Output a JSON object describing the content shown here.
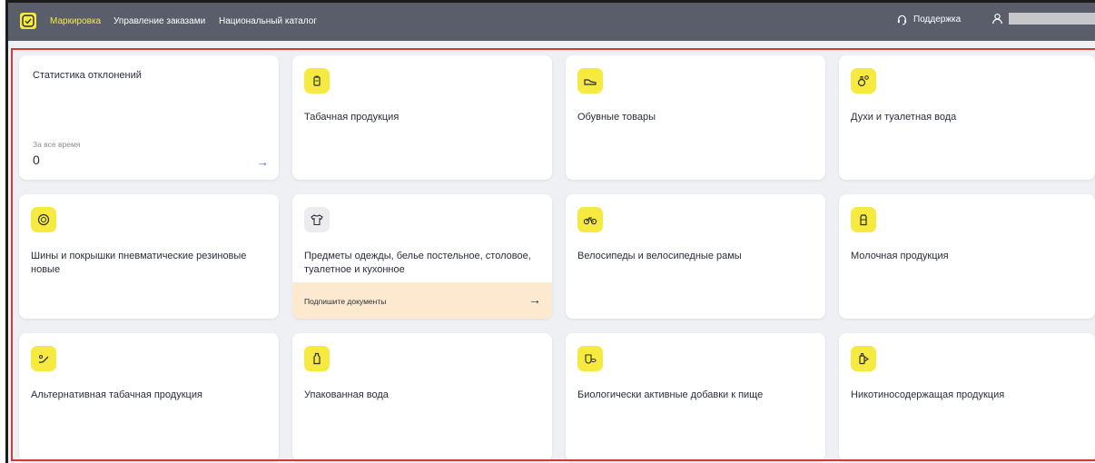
{
  "header": {
    "nav": [
      {
        "label": "Маркировка",
        "active": true
      },
      {
        "label": "Управление заказами",
        "active": false
      },
      {
        "label": "Национальный каталог",
        "active": false
      }
    ],
    "support_label": "Поддержка",
    "accent_color": "#f6e93f"
  },
  "stats_card": {
    "title": "Статистика отклонений",
    "period_label": "За все время",
    "value": "0",
    "arrow": "→"
  },
  "categories": [
    {
      "title": "Табачная продукция",
      "icon": "cigarette-pack-icon"
    },
    {
      "title": "Обувные товары",
      "icon": "shoe-icon"
    },
    {
      "title": "Духи и туалетная вода",
      "icon": "perfume-icon"
    },
    {
      "title": "Шины и покрышки пневматические резиновые новые",
      "icon": "tire-icon"
    },
    {
      "title": "Предметы одежды, белье постельное, столовое, туалетное и кухонное",
      "icon": "shirt-icon",
      "action_label": "Подпишите документы",
      "action_arrow": "→"
    },
    {
      "title": "Велосипеды и велосипедные рамы",
      "icon": "bicycle-icon"
    },
    {
      "title": "Молочная продукция",
      "icon": "milk-icon"
    },
    {
      "title": "Альтернативная табачная продукция",
      "icon": "pipe-icon"
    },
    {
      "title": "Упакованная вода",
      "icon": "water-bottle-icon"
    },
    {
      "title": "Биологически активные добавки к пище",
      "icon": "supplement-icon"
    },
    {
      "title": "Никотиносодержащая продукция",
      "icon": "vape-icon"
    }
  ]
}
